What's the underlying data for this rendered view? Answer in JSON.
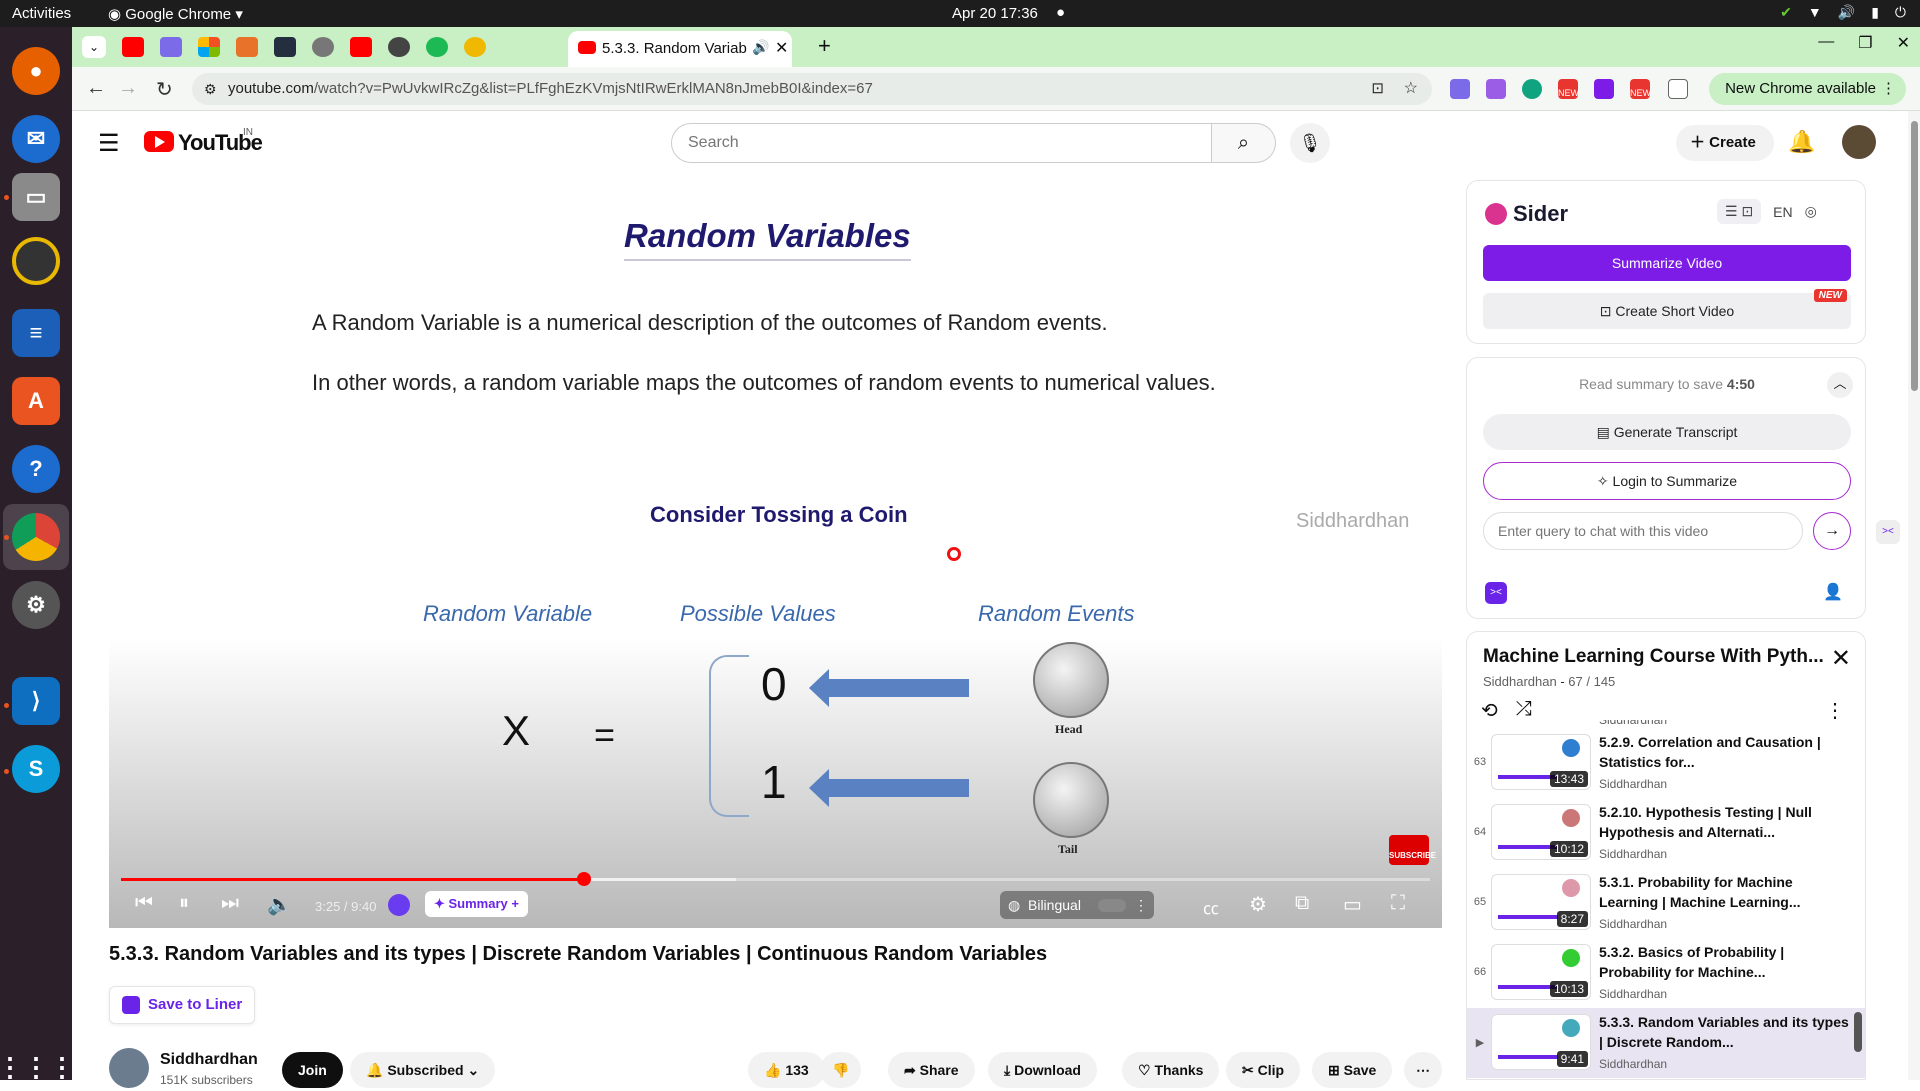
{
  "os": {
    "activities": "Activities",
    "app_name": "Google Chrome",
    "date_time": "Apr 20  17:36"
  },
  "browser": {
    "active_tab_title": "5.3.3. Random Variab",
    "url_domain": "youtube.com",
    "url_path": "/watch?v=PwUvkwIRcZg&list=PLfFghEzKVmjsNtIRwErklMAN8nJmebB0I&index=67",
    "new_chrome": "New Chrome available",
    "new_badge": "NEW"
  },
  "youtube": {
    "logo_text": "YouTube",
    "region": "IN",
    "search_placeholder": "Search",
    "create_label": "Create"
  },
  "slide": {
    "title": "Random Variables",
    "line1": "A Random Variable is a numerical description of the outcomes of Random events.",
    "line2": "In other words, a random variable maps the outcomes of random events to numerical values.",
    "subheading": "Consider Tossing a Coin",
    "watermark": "Siddhardhan",
    "col_random_variable": "Random Variable",
    "col_possible_values": "Possible Values",
    "col_random_events": "Random Events",
    "variable": "X",
    "equals": "=",
    "value0": "0",
    "value1": "1",
    "head_label": "Head",
    "tail_label": "Tail",
    "subscribe": "SUBSCRIBE"
  },
  "player": {
    "time": "3:25 / 9:40",
    "progress_fraction": 0.354,
    "buffered_fraction": 0.47,
    "summary_label": "Summary +",
    "bilingual_label": "Bilingual"
  },
  "video": {
    "title": "5.3.3. Random Variables and its types | Discrete Random Variables | Continuous Random Variables",
    "save_to_liner": "Save to Liner",
    "channel": "Siddhardhan",
    "subscribers": "151K subscribers",
    "join": "Join",
    "subscribed": "Subscribed",
    "likes": "133",
    "share": "Share",
    "download": "Download",
    "thanks": "Thanks",
    "clip": "Clip",
    "save": "Save"
  },
  "sider": {
    "brand": "Sider",
    "lang": "EN",
    "summarize_video": "Summarize Video",
    "create_short_video": "Create Short Video",
    "new_badge": "NEW",
    "read_summary_text": "Read summary to save",
    "read_summary_time": "4:50",
    "generate_transcript": "Generate Transcript",
    "login_to_summarize": "Login to Summarize",
    "query_placeholder": "Enter query to chat with this video"
  },
  "playlist": {
    "title": "Machine Learning Course With Pyth...",
    "channel": "Siddhardhan",
    "position": "67 / 145",
    "partial_channel": "Siddhardhan",
    "items": [
      {
        "num": "63",
        "title": "5.2.9. Correlation and Causation | Statistics for...",
        "channel": "Siddhardhan",
        "duration": "13:43"
      },
      {
        "num": "64",
        "title": "5.2.10. Hypothesis Testing | Null Hypothesis and Alternati...",
        "channel": "Siddhardhan",
        "duration": "10:12"
      },
      {
        "num": "65",
        "title": "5.3.1. Probability for Machine Learning | Machine Learning...",
        "channel": "Siddhardhan",
        "duration": "8:27"
      },
      {
        "num": "66",
        "title": "5.3.2. Basics of Probability | Probability for Machine...",
        "channel": "Siddhardhan",
        "duration": "10:13"
      },
      {
        "num": "▶",
        "title": "5.3.3. Random Variables and its types | Discrete Random...",
        "channel": "Siddhardhan",
        "duration": "9:41"
      }
    ]
  }
}
